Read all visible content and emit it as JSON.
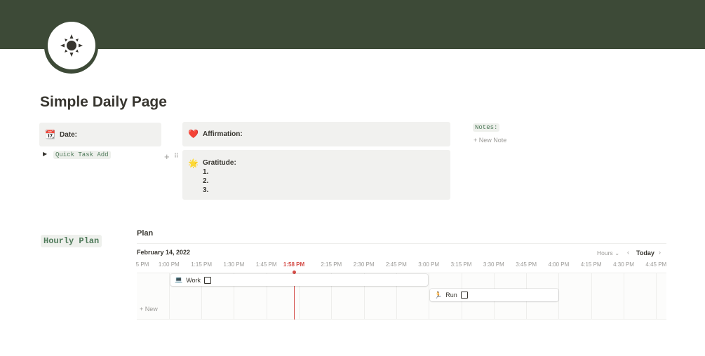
{
  "page": {
    "title": "Simple Daily Page"
  },
  "callouts": {
    "date": {
      "label": "Date:"
    },
    "affirmation": {
      "label": "Affirmation:"
    },
    "gratitude": {
      "label": "Gratitude:",
      "items": [
        "1.",
        "2.",
        "3."
      ]
    }
  },
  "quick_task": {
    "label": "Quick Task Add"
  },
  "notes": {
    "label": "Notes:",
    "new_note": "New Note"
  },
  "hourly": {
    "label": "Hourly Plan"
  },
  "timeline": {
    "title": "Plan",
    "date": "February 14, 2022",
    "view": "Hours",
    "today": "Today",
    "new": "New",
    "now": "1:58 PM",
    "times": [
      "5 PM",
      "1:00 PM",
      "1:15 PM",
      "1:30 PM",
      "1:45 PM",
      "2:15 PM",
      "2:30 PM",
      "2:45 PM",
      "3:00 PM",
      "3:15 PM",
      "3:30 PM",
      "3:45 PM",
      "4:00 PM",
      "4:15 PM",
      "4:30 PM",
      "4:45 PM"
    ],
    "events": [
      {
        "title": "Work",
        "start": "1:00 PM",
        "end": "3:00 PM"
      },
      {
        "title": "Run",
        "start": "3:00 PM",
        "end": "4:00 PM"
      }
    ]
  },
  "colors": {
    "cover": "#3d4a37",
    "now_line": "#d44c47",
    "callout_bg": "#f1f1ef"
  }
}
